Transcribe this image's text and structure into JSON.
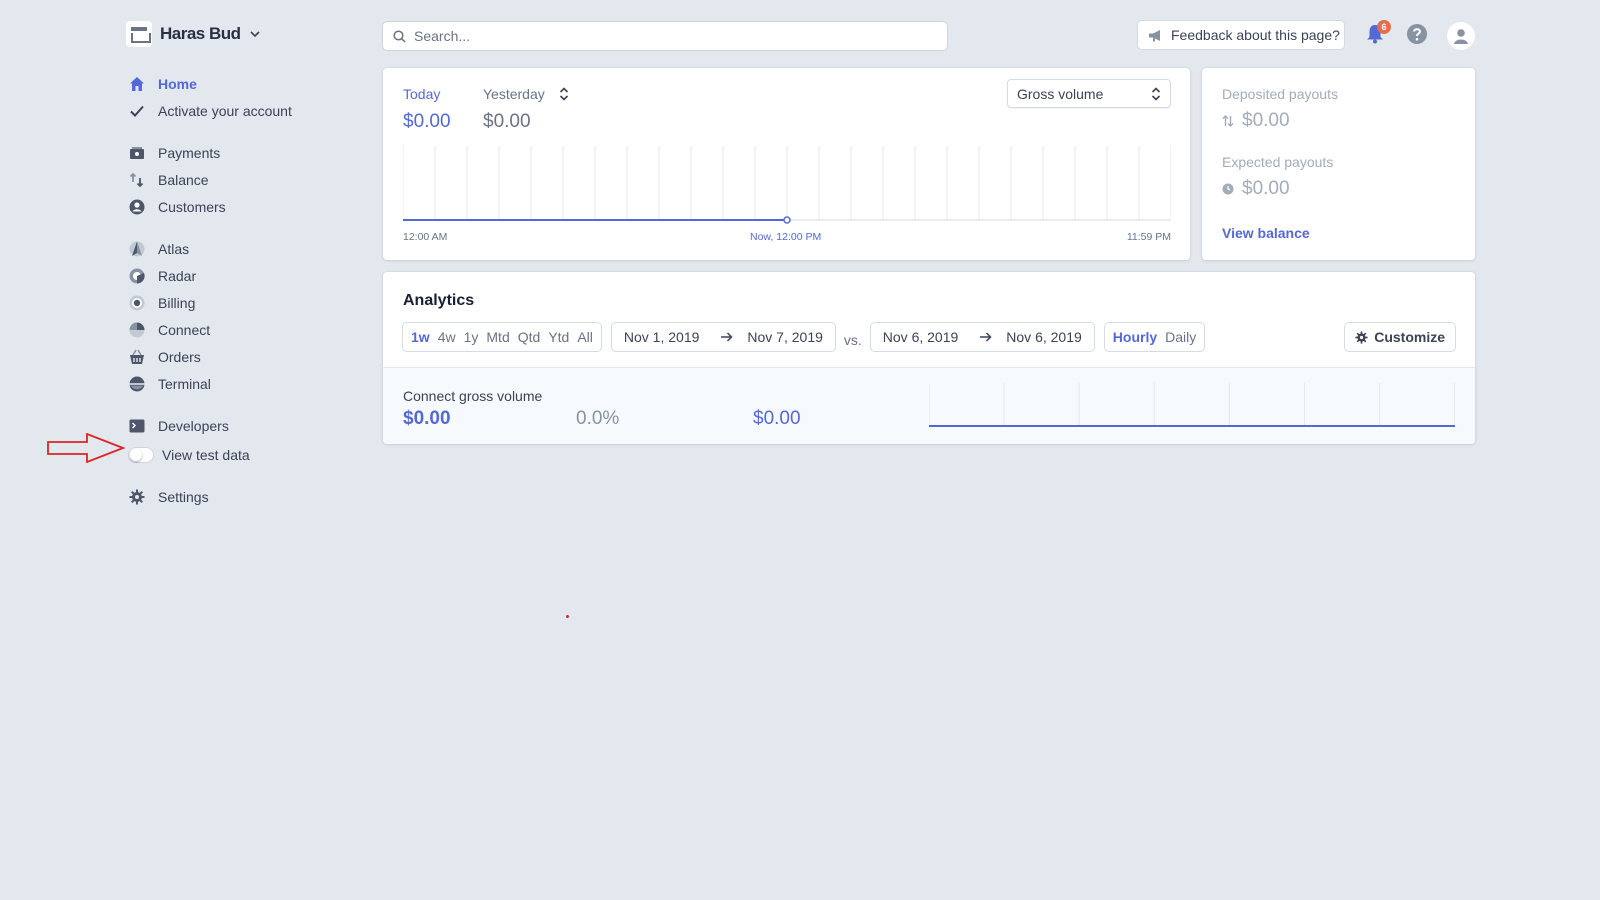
{
  "account": {
    "name": "Haras Bud",
    "chevron_icon": "chevron-down-icon"
  },
  "search": {
    "placeholder": "Search...",
    "value": ""
  },
  "feedback": {
    "label": "Feedback about this page?"
  },
  "notifications": {
    "count": "6"
  },
  "sidebar": {
    "groups": [
      [
        {
          "label": "Home",
          "icon": "home-icon",
          "active": true
        },
        {
          "label": "Activate your account",
          "icon": "checkmark-icon"
        }
      ],
      [
        {
          "label": "Payments",
          "icon": "payments-icon"
        },
        {
          "label": "Balance",
          "icon": "balance-icon"
        },
        {
          "label": "Customers",
          "icon": "customers-icon"
        }
      ],
      [
        {
          "label": "Atlas",
          "icon": "atlas-icon"
        },
        {
          "label": "Radar",
          "icon": "radar-icon"
        },
        {
          "label": "Billing",
          "icon": "billing-icon"
        },
        {
          "label": "Connect",
          "icon": "connect-icon"
        },
        {
          "label": "Orders",
          "icon": "orders-icon"
        },
        {
          "label": "Terminal",
          "icon": "terminal-icon"
        }
      ],
      [
        {
          "label": "Developers",
          "icon": "developers-icon"
        }
      ]
    ],
    "test_data_label": "View test data",
    "test_data_on": false,
    "settings_label": "Settings"
  },
  "volume": {
    "tab_today": "Today",
    "tab_yesterday": "Yesterday",
    "today_amount": "$0.00",
    "yesterday_amount": "$0.00",
    "metric": "Gross volume",
    "x_start": "12:00 AM",
    "x_now": "Now, 12:00 PM",
    "x_end": "11:59 PM"
  },
  "payouts": {
    "deposited_label": "Deposited payouts",
    "deposited_amount": "$0.00",
    "expected_label": "Expected payouts",
    "expected_amount": "$0.00",
    "view_balance": "View balance"
  },
  "analytics": {
    "title": "Analytics",
    "ranges": [
      "1w",
      "4w",
      "1y",
      "Mtd",
      "Qtd",
      "Ytd",
      "All"
    ],
    "selected_range": "1w",
    "current_start": "Nov 1, 2019",
    "current_end": "Nov 7, 2019",
    "vs_label": "vs.",
    "compare_start": "Nov 6, 2019",
    "compare_end": "Nov 6, 2019",
    "granularity": [
      "Hourly",
      "Daily"
    ],
    "selected_granularity": "Hourly",
    "customize_label": "Customize",
    "metric_name": "Connect gross volume",
    "metric_value": "$0.00",
    "metric_change": "0.0%",
    "metric_previous": "$0.00"
  },
  "colors": {
    "accent": "#5469d4",
    "background": "#e3e8ee",
    "annotation_arrow": "#e02424"
  }
}
